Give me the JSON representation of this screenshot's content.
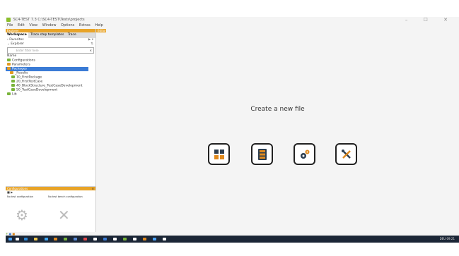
{
  "window": {
    "title": "SC4-TEST 7.3   C:\\SC4-TEST\\Tests\\projects",
    "controls": "– ☐ ✕"
  },
  "menu": [
    "File",
    "Edit",
    "View",
    "Window",
    "Options",
    "Extras",
    "Help"
  ],
  "left_panel": {
    "header": "Explorer",
    "tabs": [
      "Workspace",
      "Trace step templates",
      "Trace"
    ],
    "favorites_label": "Favorites",
    "explorer_label": "Explorer",
    "filter_placeholder": "Enter filter here",
    "name_column": "Name",
    "tree": [
      "Configurations",
      "Parameters",
      "Packages",
      "_Results",
      "10_FirstPackage",
      "20_FirstTestCase",
      "40_BlockStructure_TestCaseDevelopment",
      "50_TestCaseDevelopment",
      "Lib"
    ]
  },
  "config_panel": {
    "header": "Configurations",
    "col1": "No test configuration",
    "col2": "No test bench configuration"
  },
  "editor": {
    "header": "Editor",
    "create_label": "Create a new file",
    "buttons": [
      "new-package-button",
      "new-testcase-button",
      "new-config-button",
      "new-tools-button"
    ]
  },
  "taskbar": {
    "tray_text": "DEU  09:21"
  },
  "colors": {
    "accent": "#e8a428",
    "selection": "#3a7bd5",
    "taskbar": "#1b2636"
  }
}
